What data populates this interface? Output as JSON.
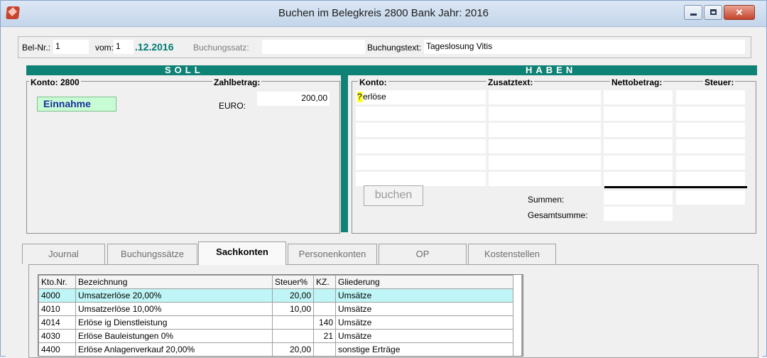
{
  "window": {
    "title": "Buchen im Belegkreis 2800 Bank Jahr: 2016",
    "buttons": {
      "minimize": "–",
      "maximize": "□",
      "close": "✕"
    }
  },
  "header": {
    "bel_nr_label": "Bel-Nr.:",
    "bel_nr_value": "1",
    "vom_label": "vom:",
    "vom_day": "1",
    "vom_rest": ".12.2016",
    "buchungssatz_label": "Buchungssatz:",
    "buchungssatz_value": "",
    "buchungstext_label": "Buchungstext:",
    "buchungstext_value": "Tageslosung Vitis"
  },
  "soll": {
    "banner": "SOLL",
    "konto_label": "Konto: 2800",
    "zahlbetrag_label": "Zahlbetrag:",
    "badge": "Einnahme",
    "currency_label": "EURO:",
    "amount": "200,00"
  },
  "haben": {
    "banner": "HABEN",
    "columns": [
      "Konto:",
      "Zusatztext:",
      "Nettobetrag:",
      "Steuer:"
    ],
    "first_konto_prefix": "?",
    "first_konto_value": "erlöse",
    "buchen_label": "buchen",
    "summen_label": "Summen:",
    "gesamtsumme_label": "Gesamtsumme:"
  },
  "tabs": [
    {
      "label": "Journal",
      "active": false
    },
    {
      "label": "Buchungssätze",
      "active": false
    },
    {
      "label": "Sachkonten",
      "active": true
    },
    {
      "label": "Personenkonten",
      "active": false
    },
    {
      "label": "OP",
      "active": false
    },
    {
      "label": "Kostenstellen",
      "active": false
    }
  ],
  "accounts_table": {
    "columns": [
      "Kto.Nr.",
      "Bezeichnung",
      "Steuer%",
      "KZ.",
      "Gliederung"
    ],
    "rows": [
      {
        "nr": "4000",
        "bez": "Umsatzerlöse 20,00%",
        "steuer": "20,00",
        "kz": "",
        "gl": "Umsätze",
        "selected": true
      },
      {
        "nr": "4010",
        "bez": "Umsatzerlöse 10,00%",
        "steuer": "10,00",
        "kz": "",
        "gl": "Umsätze",
        "selected": false
      },
      {
        "nr": "4014",
        "bez": "Erlöse ig Dienstleistung",
        "steuer": "",
        "kz": "140",
        "gl": "Umsätze",
        "selected": false
      },
      {
        "nr": "4030",
        "bez": "Erlöse Bauleistungen 0%",
        "steuer": "",
        "kz": "21",
        "gl": "Umsätze",
        "selected": false
      },
      {
        "nr": "4400",
        "bez": "Erlöse Anlagenverkauf 20,00%",
        "steuer": "20,00",
        "kz": "",
        "gl": "sonstige Erträge",
        "selected": false
      }
    ]
  },
  "colors": {
    "teal": "#0f8276",
    "badge_bg": "#c8fcd4",
    "selected_row": "#bff5f6"
  }
}
